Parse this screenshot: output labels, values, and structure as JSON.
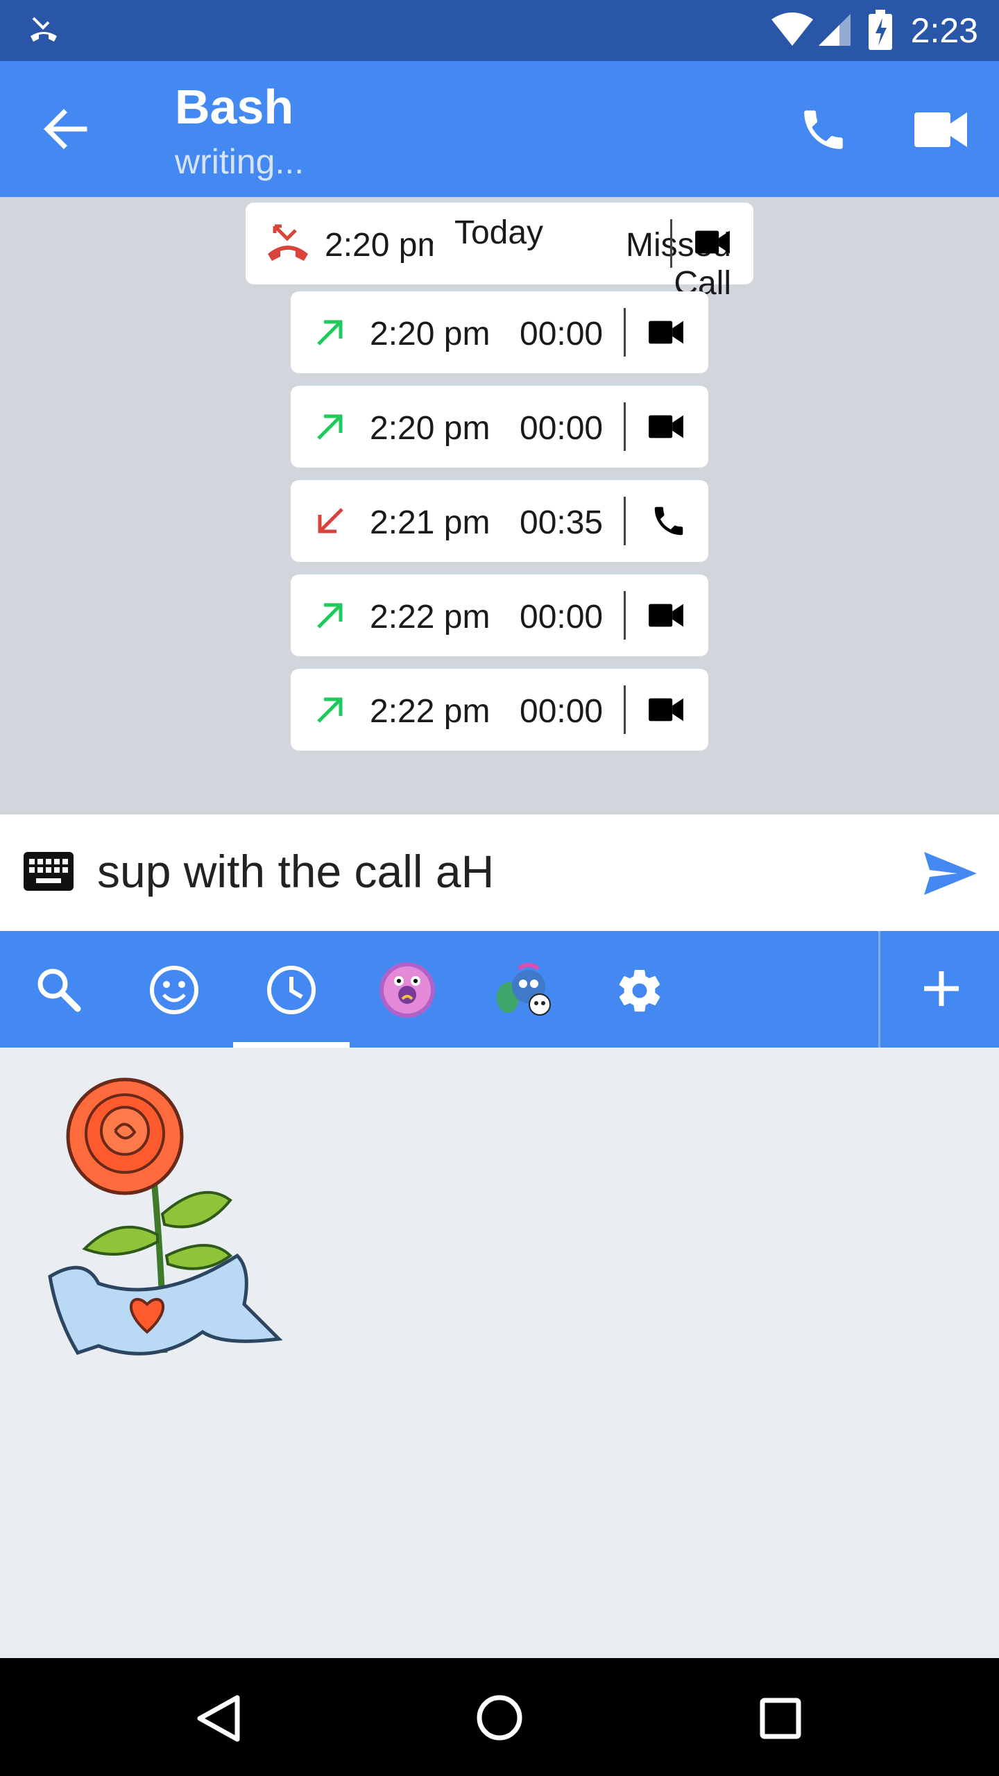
{
  "status_bar": {
    "time": "2:23"
  },
  "header": {
    "contact_name": "Bash",
    "status": "writing..."
  },
  "date_label": "Today",
  "calls": [
    {
      "time": "2:20 pm",
      "info": "Missed Call",
      "direction": "missed",
      "type": "video"
    },
    {
      "time": "2:20 pm",
      "info": "00:00",
      "direction": "outgoing",
      "type": "video"
    },
    {
      "time": "2:20 pm",
      "info": "00:00",
      "direction": "outgoing",
      "type": "video"
    },
    {
      "time": "2:21 pm",
      "info": "00:35",
      "direction": "incoming",
      "type": "voice"
    },
    {
      "time": "2:22 pm",
      "info": "00:00",
      "direction": "outgoing",
      "type": "video"
    },
    {
      "time": "2:22 pm",
      "info": "00:00",
      "direction": "outgoing",
      "type": "video"
    }
  ],
  "composer": {
    "text": "sup with the call aH"
  },
  "sticker_tabs": [
    "search",
    "emoji",
    "recent",
    "donut-pack",
    "monster-pack",
    "settings"
  ],
  "colors": {
    "primary": "#4489f2",
    "status_bar": "#2a56a8",
    "outgoing": "#1ecb5a",
    "missed": "#d9443a"
  }
}
